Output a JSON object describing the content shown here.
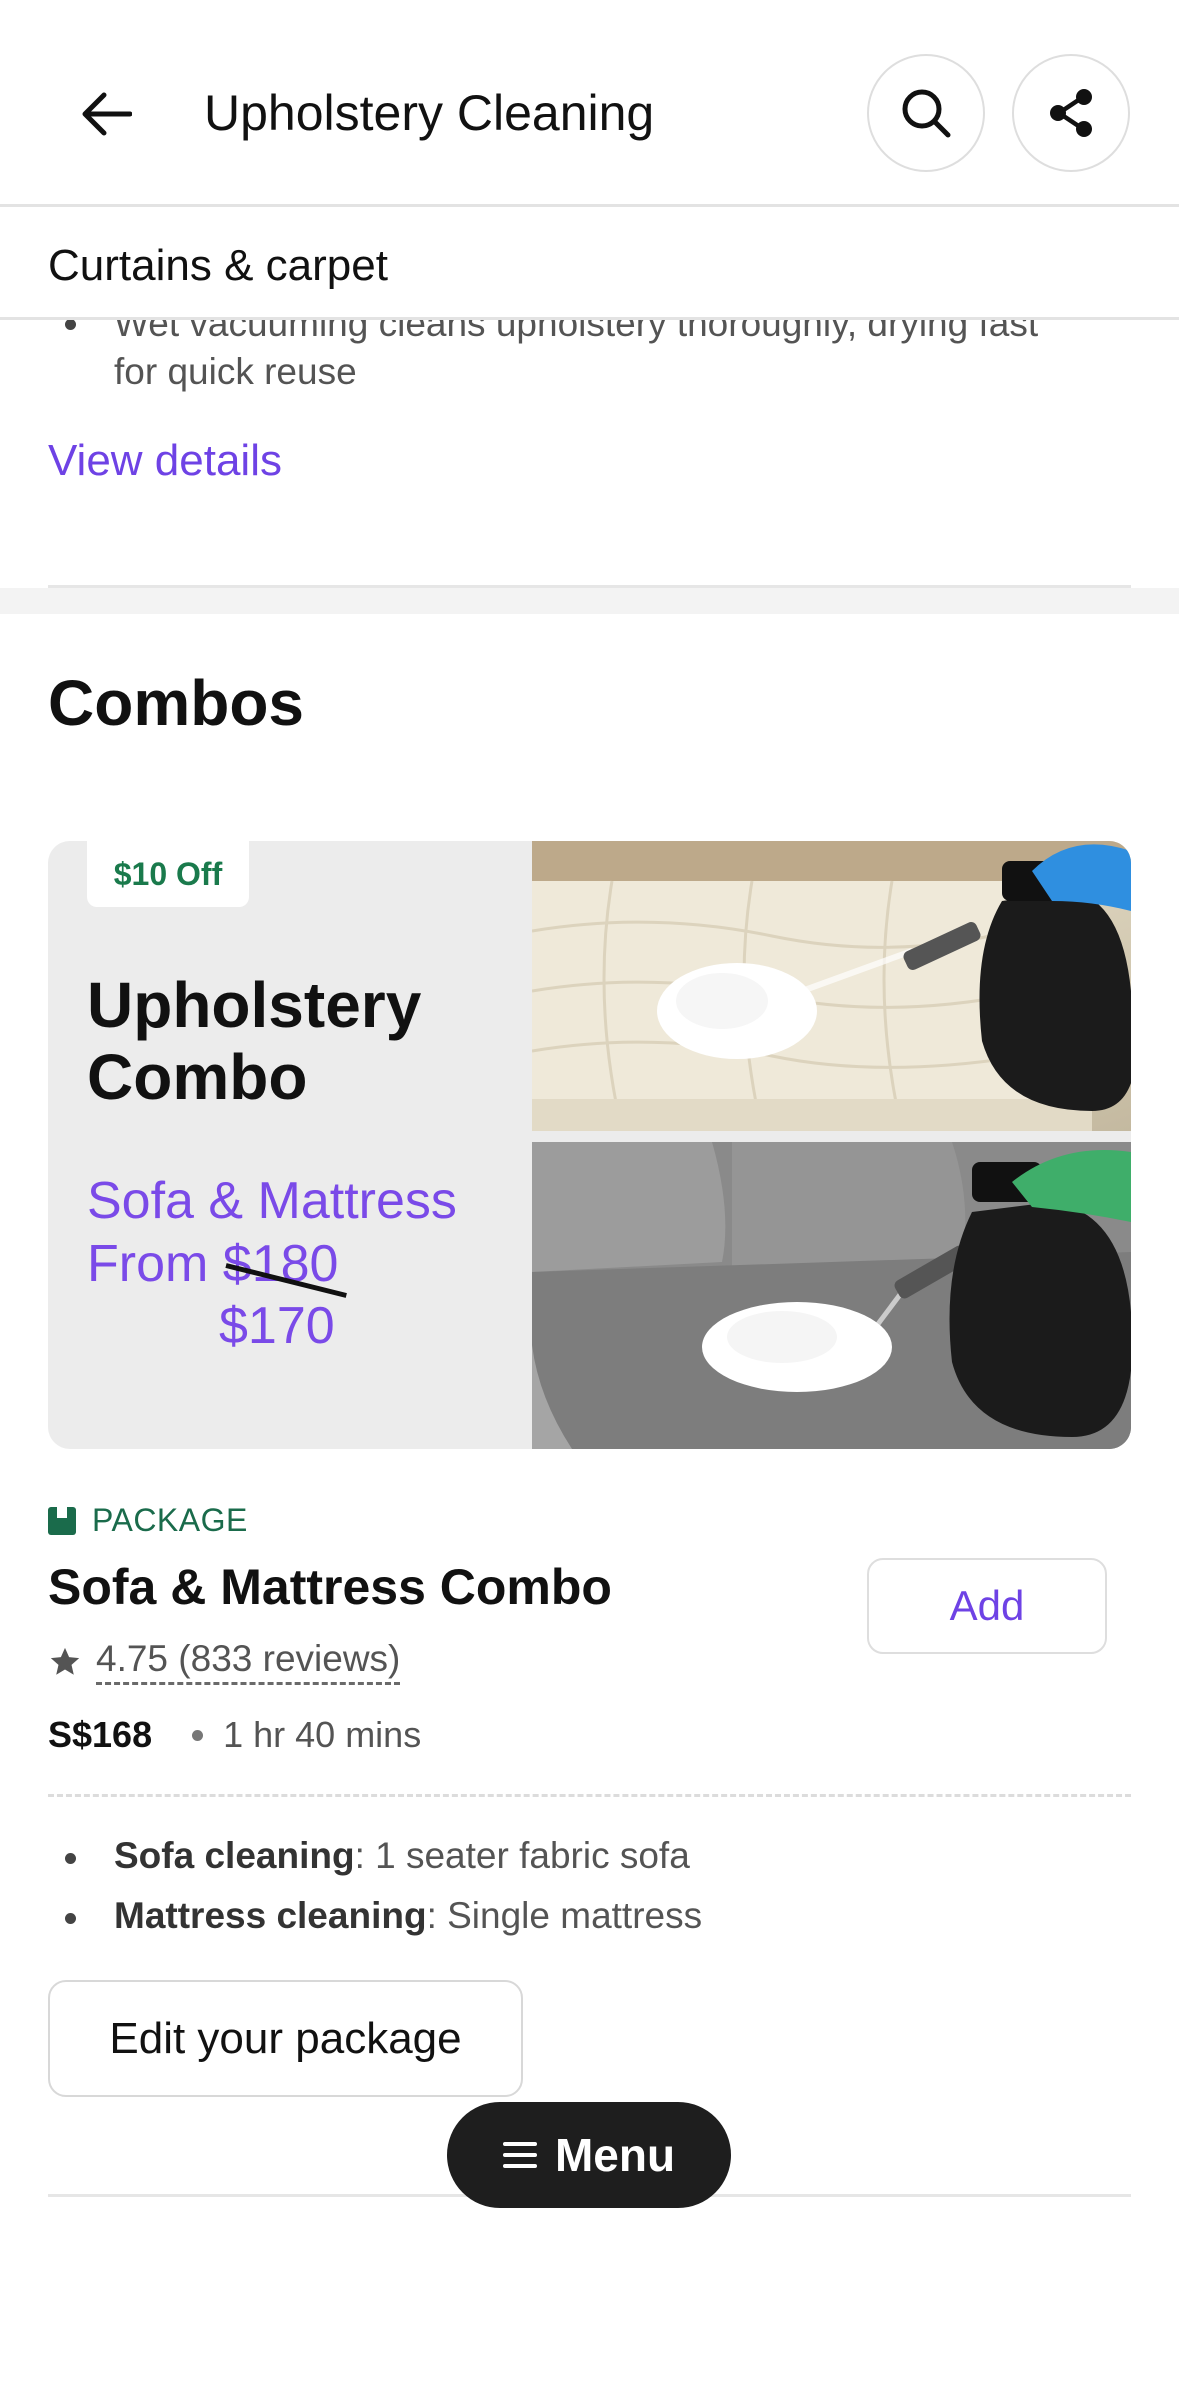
{
  "header": {
    "title": "Upholstery Cleaning",
    "back_icon": "arrow-left-icon",
    "search_icon": "search-icon",
    "share_icon": "share-icon"
  },
  "subheader": {
    "title": "Curtains & carpet"
  },
  "previous_item": {
    "bullet_line1": "Wet vacuuming cleans upholstery thoroughly, drying fast",
    "bullet_line2": "for quick reuse",
    "view_details": "View details"
  },
  "combos": {
    "section_title": "Combos",
    "banner": {
      "badge": "$10 Off",
      "title_line1": "Upholstery",
      "title_line2": "Combo",
      "subtitle": "Sofa & Mattress",
      "from_label": "From",
      "old_price": "$180",
      "new_price": "$170"
    },
    "package": {
      "tag": "PACKAGE",
      "title": "Sofa & Mattress Combo",
      "rating": "4.75 (833 reviews)",
      "price": "S$168",
      "duration": "1 hr 40 mins",
      "add_label": "Add",
      "features": [
        {
          "name": "Sofa cleaning",
          "detail": ": 1 seater fabric sofa"
        },
        {
          "name": "Mattress cleaning",
          "detail": ": Single mattress"
        }
      ],
      "edit_label": "Edit your package"
    }
  },
  "menu": {
    "label": "Menu",
    "icon": "hamburger-icon"
  },
  "colors": {
    "accent": "#6e42e5",
    "package_green": "#1a6b4b",
    "menu_bg": "#1e1e1e"
  }
}
